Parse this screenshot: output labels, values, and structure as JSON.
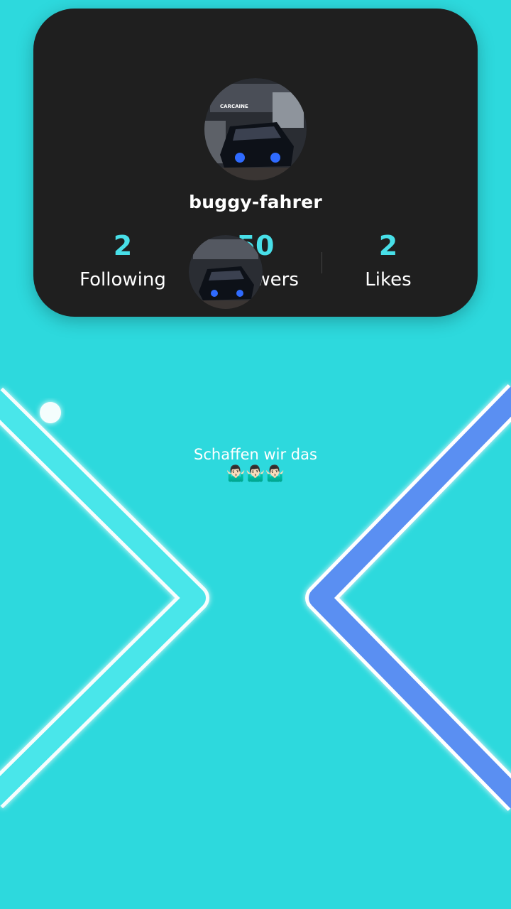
{
  "profile": {
    "username": "buggy-fahrer",
    "avatar_icon": "car-photo-avatar",
    "avatar_text": "CARCAINE"
  },
  "stats": {
    "following_value": "2",
    "following_label": "Following",
    "followers_value": "50",
    "followers_label": "Followers",
    "likes_value": "2",
    "likes_label": "Likes"
  },
  "caption": {
    "text": "Schaffen wir das",
    "emojis": "🤷🏻‍♂️🤷🏻‍♂️🤷🏻‍♂️"
  },
  "colors": {
    "background": "#2dd9dd",
    "card": "#1f1f1f",
    "accent": "#48dfe8",
    "left_path": "#48e6ea",
    "right_path": "#5a8ff2",
    "ball": "#ffffff"
  }
}
